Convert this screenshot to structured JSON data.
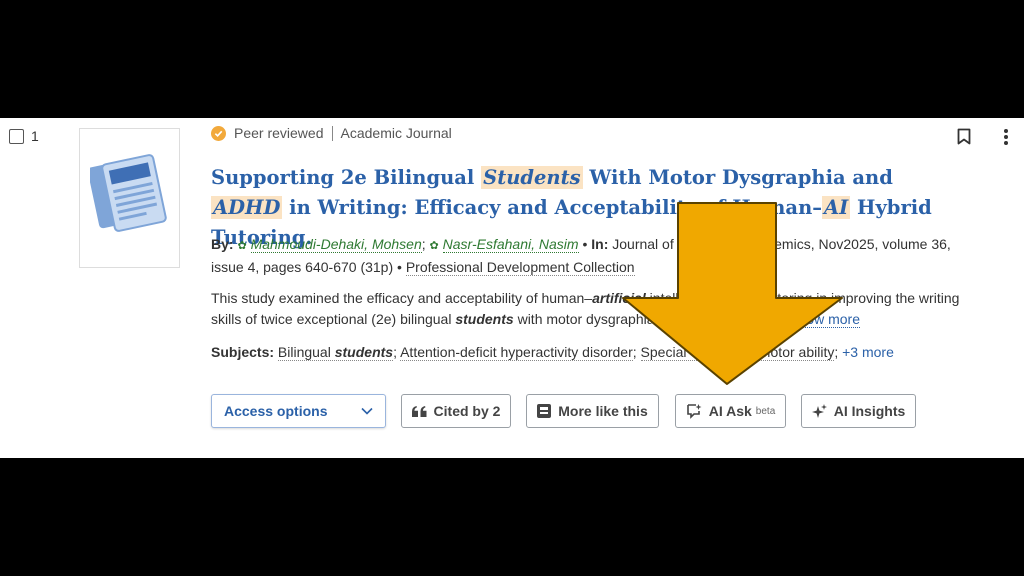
{
  "result": {
    "number": "1",
    "peer_reviewed": "Peer reviewed",
    "pub_type": "Academic Journal",
    "title": {
      "part1": "Supporting 2e Bilingual ",
      "hl1": "Students",
      "part2": " With Motor Dysgraphia and ",
      "hl2": "ADHD",
      "part3": " in Writing: Efficacy and Acceptability of Human–",
      "hl3": "AI",
      "part4": " Hybrid Tutoring."
    },
    "byline": {
      "by_label": "By:",
      "author1": "Mahmoudi-Dehaki, Mohsen",
      "author2": "Nasr-Esfahani, Nasim",
      "in_label": "In:",
      "source": "Journal of Advanced Academics, Nov2025, volume 36, issue 4, pages 640-670 (31p)",
      "collection": "Professional Development Collection"
    },
    "abstract": {
      "text1": "This study examined the efficacy and acceptability of human–",
      "em1": "artificial",
      "text2": " intelligence hybrid tutoring in improving the writing skills of twice exceptional (2e) bilingual ",
      "em2": "students",
      "text3": " with motor dysgraphia and attention-defic...",
      "show_more": "Show more"
    },
    "subjects": {
      "label": "Subjects:",
      "s1a": "Bilingual ",
      "s1b": "students",
      "s2": "Attention-deficit hyperactivity disorder",
      "s3": "Special education",
      "s4": "Motor ability",
      "more": "+3 more"
    },
    "actions": {
      "access": "Access options",
      "cited": "Cited by 2",
      "more_like": "More like this",
      "ai_ask": "AI Ask",
      "ai_ask_badge": "beta",
      "ai_insights": "AI Insights"
    }
  },
  "colors": {
    "link_blue": "#2b61a8",
    "highlight": "#fbe3c3",
    "author_green": "#2f7a32",
    "arrow": "#f0a800",
    "peer_badge": "#f2a93b"
  },
  "icons": [
    "check-icon",
    "bookmark-icon",
    "more-vert-icon",
    "chevron-down-icon",
    "quote-icon",
    "more-like-icon",
    "ai-ask-icon",
    "sparkle-icon",
    "document-thumbnail-icon",
    "arrow-down-annotation"
  ]
}
